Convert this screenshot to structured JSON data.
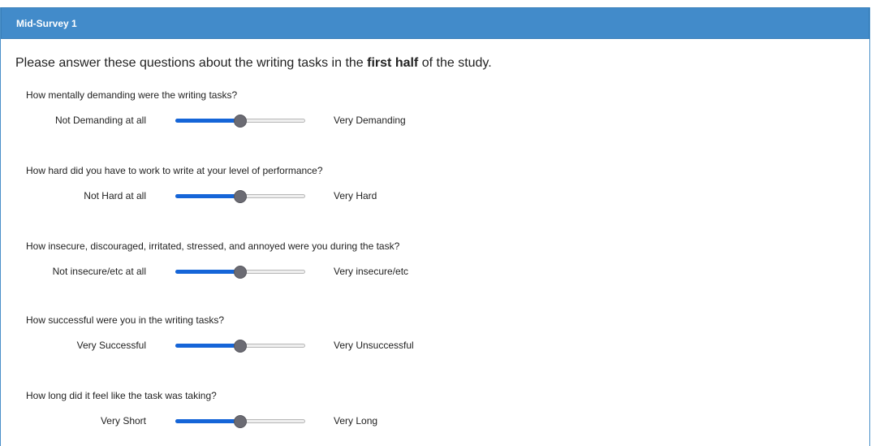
{
  "header": {
    "title": "Mid-Survey 1"
  },
  "intro": {
    "before": "Please answer these questions about the writing tasks in the ",
    "bold": "first half",
    "after": " of the study."
  },
  "questions": [
    {
      "text": "How mentally demanding were the writing tasks?",
      "left_label": "Not Demanding at all",
      "right_label": "Very Demanding",
      "value": 0.5
    },
    {
      "text": "How hard did you have to work to write at your level of performance?",
      "left_label": "Not Hard at all",
      "right_label": "Very Hard",
      "value": 0.5
    },
    {
      "text": "How insecure, discouraged, irritated, stressed, and annoyed were you during the task?",
      "left_label": "Not insecure/etc at all",
      "right_label": "Very insecure/etc",
      "value": 0.5
    },
    {
      "text": "How successful were you in the writing tasks?",
      "left_label": "Very Successful",
      "right_label": "Very Unsuccessful",
      "value": 0.5
    },
    {
      "text": "How long did it feel like the task was taking?",
      "left_label": "Very Short",
      "right_label": "Very Long",
      "value": 0.5
    }
  ],
  "colors": {
    "header_bg": "#428bca",
    "slider_fill": "#1565d8",
    "slider_thumb": "#6b6b73"
  }
}
